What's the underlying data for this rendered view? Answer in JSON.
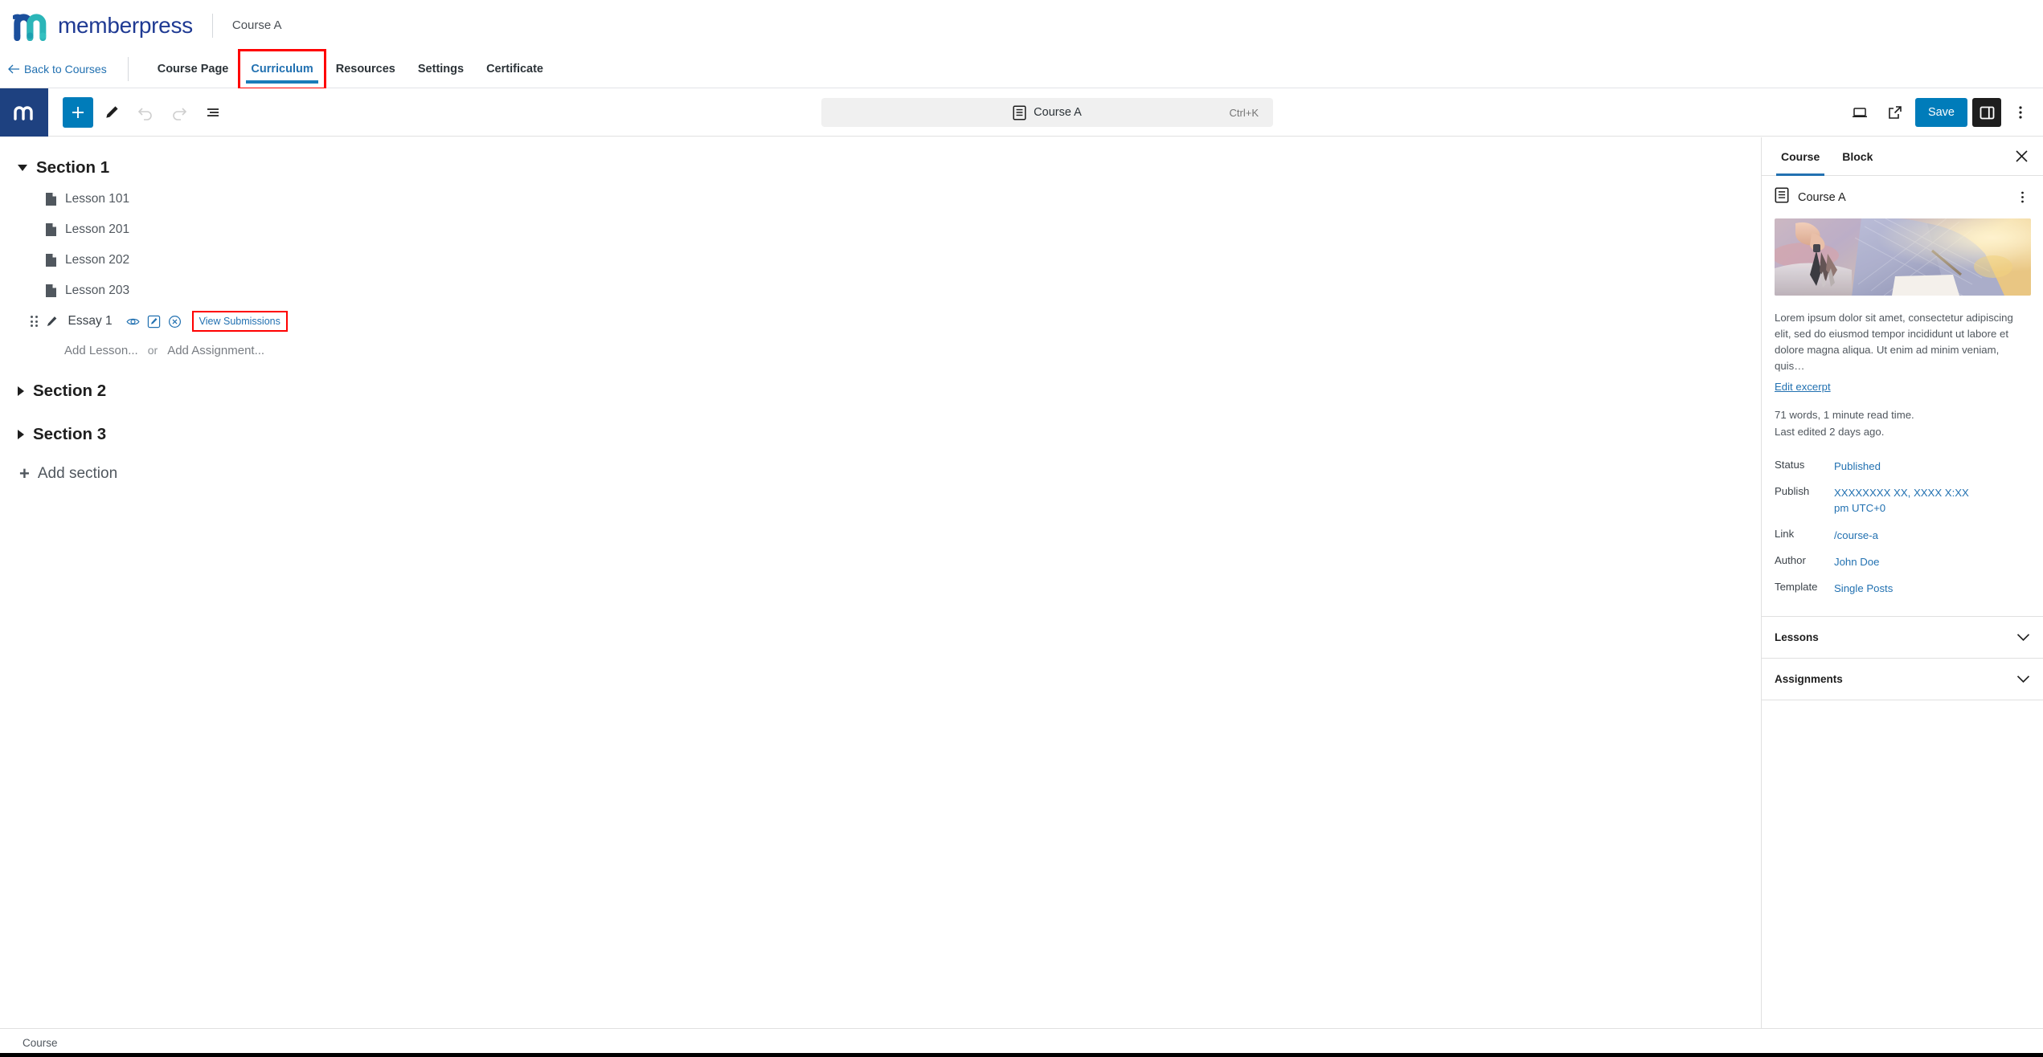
{
  "brand": {
    "name": "memberpress",
    "logo_icon": "memberpress-m-logo",
    "color": "#1f3a93",
    "accent_teal": "#3bbfc4"
  },
  "topbar": {
    "breadcrumb_title": "Course A"
  },
  "navbar": {
    "back_label": "Back to Courses",
    "back_icon": "arrow-left-icon",
    "items": [
      {
        "label": "Course Page",
        "active": false,
        "highlighted": false
      },
      {
        "label": "Curriculum",
        "active": true,
        "highlighted": true
      },
      {
        "label": "Resources",
        "active": false,
        "highlighted": false
      },
      {
        "label": "Settings",
        "active": false,
        "highlighted": false
      },
      {
        "label": "Certificate",
        "active": false,
        "highlighted": false
      }
    ]
  },
  "editor_header": {
    "site_hub_icon": "memberpress-m-icon",
    "add_block_label": "+",
    "tools": [
      {
        "name": "add-block-button",
        "icon": "plus-icon"
      },
      {
        "name": "edit-tool-button",
        "icon": "pencil-icon"
      },
      {
        "name": "undo-button",
        "icon": "undo-icon"
      },
      {
        "name": "redo-button",
        "icon": "redo-icon"
      },
      {
        "name": "document-overview-button",
        "icon": "list-view-icon"
      }
    ],
    "command_bar": {
      "icon": "document-icon",
      "title": "Course A",
      "shortcut": "Ctrl+K"
    },
    "right": {
      "preview_icon": "desktop-preview-icon",
      "view_icon": "external-link-icon",
      "save_label": "Save",
      "sidebar_toggle_icon": "sidebar-panel-icon",
      "options_icon": "kebab-menu-icon"
    },
    "accent_color": "#007cba"
  },
  "curriculum": {
    "sections": [
      {
        "title": "Section 1",
        "expanded": true,
        "lessons": [
          {
            "title": "Lesson 101",
            "icon": "page-icon"
          },
          {
            "title": "Lesson 201",
            "icon": "page-icon"
          },
          {
            "title": "Lesson 202",
            "icon": "page-icon"
          },
          {
            "title": "Lesson 203",
            "icon": "page-icon"
          }
        ],
        "assignment": {
          "title": "Essay 1",
          "drag_icon": "drag-handle-icon",
          "type_icon": "pencil-icon",
          "actions": [
            {
              "name": "preview-icon",
              "label": "eye"
            },
            {
              "name": "edit-icon",
              "label": "edit-square"
            },
            {
              "name": "remove-icon",
              "label": "x-circle"
            }
          ],
          "view_submissions_label": "View Submissions",
          "view_submissions_highlighted": true
        },
        "add_lesson_label": "Add Lesson...",
        "or_label": "or",
        "add_assignment_label": "Add Assignment..."
      },
      {
        "title": "Section 2",
        "expanded": false
      },
      {
        "title": "Section 3",
        "expanded": false
      }
    ],
    "add_section_label": "Add section",
    "add_section_icon": "plus-icon"
  },
  "sidebar": {
    "tabs": [
      {
        "label": "Course",
        "active": true
      },
      {
        "label": "Block",
        "active": false
      }
    ],
    "close_icon": "close-icon",
    "document": {
      "icon": "document-icon",
      "title": "Course A",
      "kebab_icon": "kebab-menu-icon"
    },
    "featured_image_alt": "person holding car keys",
    "excerpt": "Lorem ipsum dolor sit amet, consectetur adipiscing elit, sed do eiusmod tempor incididunt ut labore et dolore magna aliqua. Ut enim ad minim veniam, quis…",
    "edit_excerpt_label": "Edit excerpt",
    "word_count": "71 words, 1 minute read time.",
    "last_edited": "Last edited 2 days ago.",
    "rows": [
      {
        "label": "Status",
        "value": "Published"
      },
      {
        "label": "Publish",
        "value": "XXXXXXXX XX, XXXX X:XX pm UTC+0"
      },
      {
        "label": "Link",
        "value": "/course-a"
      },
      {
        "label": "Author",
        "value": "John Doe"
      },
      {
        "label": "Template",
        "value": "Single Posts"
      }
    ],
    "panels": [
      {
        "label": "Lessons",
        "icon": "chevron-down-icon"
      },
      {
        "label": "Assignments",
        "icon": "chevron-down-icon"
      }
    ]
  },
  "statusbar": {
    "label": "Course"
  }
}
